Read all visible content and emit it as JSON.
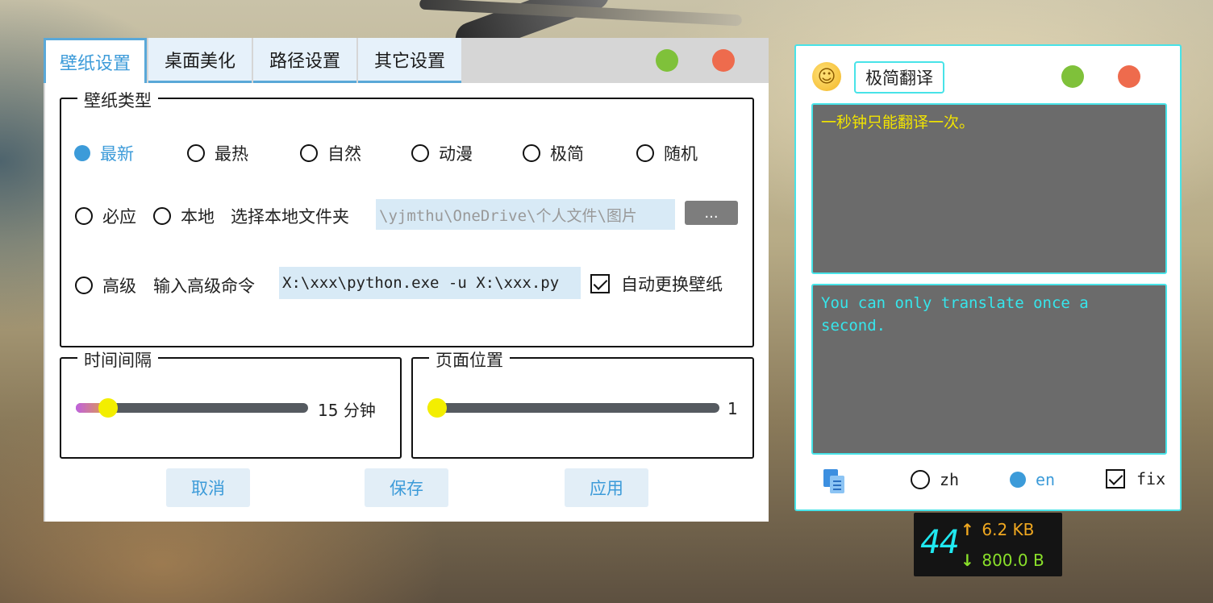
{
  "settings_window": {
    "tabs": [
      {
        "label": "壁纸设置",
        "active": true
      },
      {
        "label": "桌面美化",
        "active": false
      },
      {
        "label": "路径设置",
        "active": false
      },
      {
        "label": "其它设置",
        "active": false
      }
    ],
    "wallpaper_group": {
      "title": "壁纸类型",
      "sources": [
        {
          "label": "最新",
          "selected": true
        },
        {
          "label": "最热",
          "selected": false
        },
        {
          "label": "自然",
          "selected": false
        },
        {
          "label": "动漫",
          "selected": false
        },
        {
          "label": "极简",
          "selected": false
        },
        {
          "label": "随机",
          "selected": false
        },
        {
          "label": "必应",
          "selected": false
        },
        {
          "label": "本地",
          "selected": false
        },
        {
          "label": "高级",
          "selected": false
        }
      ],
      "local_folder_label": "选择本地文件夹",
      "local_folder_placeholder": "\\yjmthu\\OneDrive\\个人文件\\图片",
      "browse_button": "...",
      "advanced_label": "输入高级命令",
      "advanced_value": "X:\\xxx\\python.exe -u X:\\xxx.py",
      "auto_change_label": "自动更换壁纸",
      "auto_change_checked": true
    },
    "interval_group": {
      "title": "时间间隔",
      "value": "15",
      "unit": "分钟",
      "level": 0.14
    },
    "page_group": {
      "title": "页面位置",
      "value": "1",
      "level": 0.0
    },
    "buttons": {
      "cancel": "取消",
      "save": "保存",
      "apply": "应用"
    },
    "colors": {
      "accent": "#3c9bd9",
      "min_button": "#7fc13a",
      "close_button": "#ee6b4d"
    }
  },
  "translator_window": {
    "title": "极简翻译",
    "icon": "smiley-icon",
    "source_text": "一秒钟只能翻译一次。",
    "translated_text": "You can only translate once a second.",
    "languages": [
      {
        "label": "zh",
        "selected": false
      },
      {
        "label": "en",
        "selected": true
      }
    ],
    "fix_label": "fix",
    "fix_checked": true,
    "colors": {
      "border": "#48e3e8",
      "source_text": "#f2e400",
      "translated_text": "#36e6ec"
    }
  },
  "net_meter": {
    "fps": "44",
    "upload": "6.2 KB",
    "download": "800.0 B",
    "up_arrow": "↑",
    "down_arrow": "↓"
  }
}
